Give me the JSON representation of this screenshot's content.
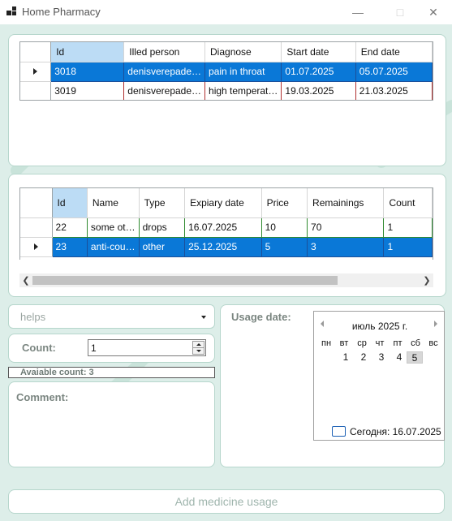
{
  "window": {
    "title": "Home Pharmacy"
  },
  "illnesses": {
    "columns": [
      "Id",
      "Illed person",
      "Diagnose",
      "Start date",
      "End date"
    ],
    "rows": [
      [
        "3018",
        "denisverepade…",
        "pain in throat",
        "01.07.2025",
        "05.07.2025"
      ],
      [
        "3019",
        "denisverepade…",
        "high temperat…",
        "19.03.2025",
        "21.03.2025"
      ]
    ],
    "selected_row": 0
  },
  "medicines": {
    "columns": [
      "Id",
      "Name",
      "Type",
      "Expiary date",
      "Price",
      "Remainings",
      "Count"
    ],
    "rows": [
      [
        "22",
        "some ot…",
        "drops",
        "16.07.2025",
        "10",
        "70",
        "1"
      ],
      [
        "23",
        "anti-cou…",
        "other",
        "25.12.2025",
        "5",
        "3",
        "1"
      ]
    ],
    "selected_row": 1
  },
  "usage_combo": {
    "value": "helps"
  },
  "count": {
    "label": "Count:",
    "value": "1"
  },
  "available": {
    "text": "Avaiable count: 3"
  },
  "comment": {
    "label": "Comment:"
  },
  "usage_date": {
    "label": "Usage date:"
  },
  "calendar": {
    "month_label": "июль 2025 г.",
    "weekdays": [
      "пн",
      "вт",
      "ср",
      "чт",
      "пт",
      "сб",
      "вс"
    ],
    "days": [
      "1",
      "2",
      "3",
      "4",
      "5"
    ],
    "highlighted_day": "5",
    "today_text": "Сегодня: 16.07.2025"
  },
  "add_button": {
    "label": "Add medicine usage"
  },
  "colors": {
    "accent": "#0a78d7",
    "panel_border": "#b6d6cc",
    "background": "#ddeee9",
    "muted_text": "#7b8681"
  }
}
